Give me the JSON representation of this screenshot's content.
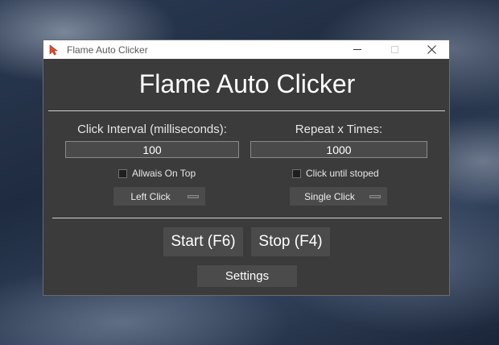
{
  "window": {
    "title": "Flame Auto Clicker",
    "controls": {
      "minimize": "—",
      "maximize": "□",
      "close": "✕"
    }
  },
  "main": {
    "heading": "Flame Auto Clicker",
    "interval": {
      "label": "Click Interval (milliseconds):",
      "value": "100"
    },
    "repeat": {
      "label": "Repeat x Times:",
      "value": "1000"
    },
    "always_on_top": {
      "label": "Allwais On Top",
      "checked": false
    },
    "click_until_stopped": {
      "label": "Click until stoped",
      "checked": false
    },
    "mouse_button": {
      "selected": "Left Click"
    },
    "click_type": {
      "selected": "Single Click"
    },
    "start_button": "Start (F6)",
    "stop_button": "Stop (F4)",
    "settings_button": "Settings"
  },
  "colors": {
    "window_bg": "#3b3b3b",
    "control_bg": "#4b4b4b",
    "text": "#ffffff",
    "icon_accent": "#e2502e"
  },
  "icons": {
    "app": "flame-cursor-icon"
  }
}
